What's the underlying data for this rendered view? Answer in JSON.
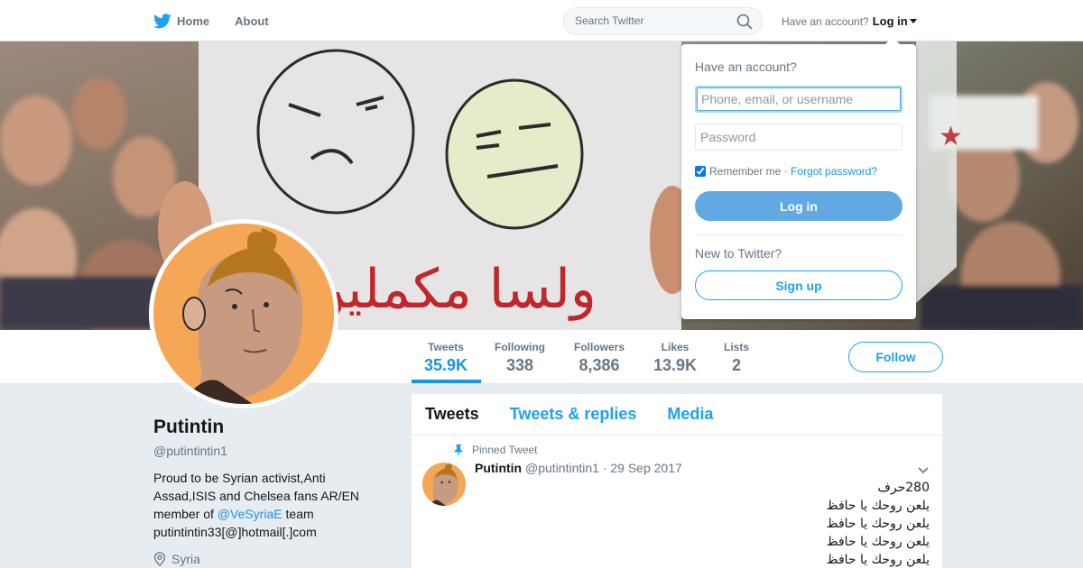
{
  "nav": {
    "home_label": "Home",
    "about_label": "About",
    "search_placeholder": "Search Twitter",
    "account_prompt": "Have an account?",
    "login_label": "Log in"
  },
  "banner": {
    "sign_text": "ولسا مكملين"
  },
  "stats": [
    {
      "label": "Tweets",
      "value": "35.9K"
    },
    {
      "label": "Following",
      "value": "338"
    },
    {
      "label": "Followers",
      "value": "8,386"
    },
    {
      "label": "Likes",
      "value": "13.9K"
    },
    {
      "label": "Lists",
      "value": "2"
    }
  ],
  "follow_label": "Follow",
  "profile": {
    "name": "Putintin",
    "handle": "@putintintin1",
    "bio_line1": "Proud to be Syrian activist,Anti Assad,ISIS and Chelsea fans AR/EN member of ",
    "bio_mention": "@VeSyriaE",
    "bio_line2": " team putintintin33[@]hotmail[.]com",
    "location": "Syria"
  },
  "timeline": {
    "tabs": [
      "Tweets",
      "Tweets & replies",
      "Media"
    ],
    "pinned_label": "Pinned Tweet",
    "tweet": {
      "name": "Putintin",
      "handle": "@putintintin1",
      "date": "· 29 Sep 2017",
      "lines": [
        "280حرف",
        "يلعن روحك يا حافظ",
        "يلعن روحك يا حافظ",
        "يلعن روحك يا حافظ",
        "يلعن روحك يا حافظ"
      ]
    }
  },
  "login_dropdown": {
    "title": "Have an account?",
    "username_placeholder": "Phone, email, or username",
    "password_placeholder": "Password",
    "remember_label": "Remember me",
    "separator": " · ",
    "forgot_label": "Forgot password?",
    "login_button": "Log in",
    "new_prompt": "New to Twitter?",
    "signup_button": "Sign up"
  },
  "colors": {
    "brand": "#1da1f2",
    "link": "#1b95e0",
    "login_button": "#62a9e4",
    "avatar_bg": "#f5a657"
  }
}
